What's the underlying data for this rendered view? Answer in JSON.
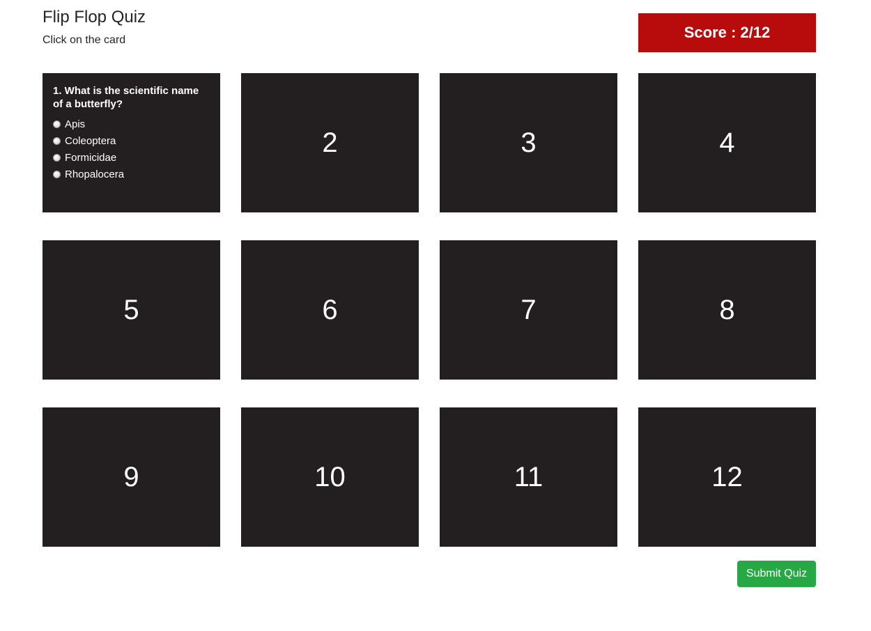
{
  "header": {
    "title": "Flip Flop Quiz",
    "subtitle": "Click on the card"
  },
  "score": {
    "label": "Score : 2/12"
  },
  "question_card": {
    "question": "1. What is the scientific name of a butterfly?",
    "options": [
      "Apis",
      "Coleoptera",
      "Formicidae",
      "Rhopalocera"
    ]
  },
  "cards": [
    "2",
    "3",
    "4",
    "5",
    "6",
    "7",
    "8",
    "9",
    "10",
    "11",
    "12"
  ],
  "submit": {
    "label": "Submit Quiz"
  },
  "colors": {
    "card_background": "#231f20",
    "score_background": "#b80c0c",
    "submit_background": "#28a745"
  }
}
